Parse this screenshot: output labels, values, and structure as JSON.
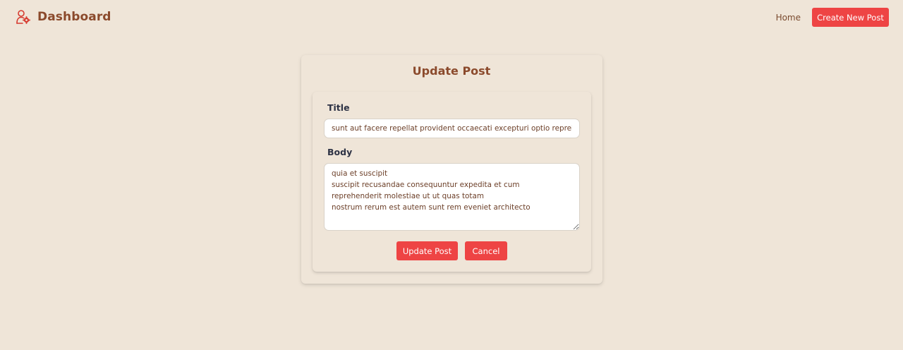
{
  "navbar": {
    "brand_title": "Dashboard",
    "brand_icon": "user-gear-icon",
    "home_label": "Home",
    "create_label": "Create New Post"
  },
  "form": {
    "heading": "Update Post",
    "title_label": "Title",
    "title_value": "sunt aut facere repellat provident occaecati excepturi optio reprehenderit",
    "body_label": "Body",
    "body_value": "quia et suscipit\nsuscipit recusandae consequuntur expedita et cum\nreprehenderit molestiae ut ut quas totam\nnostrum rerum est autem sunt rem eveniet architecto",
    "update_label": "Update Post",
    "cancel_label": "Cancel"
  },
  "colors": {
    "background": "#efe5d8",
    "accent": "#ee4444",
    "brand_text": "#8b4a2c"
  }
}
